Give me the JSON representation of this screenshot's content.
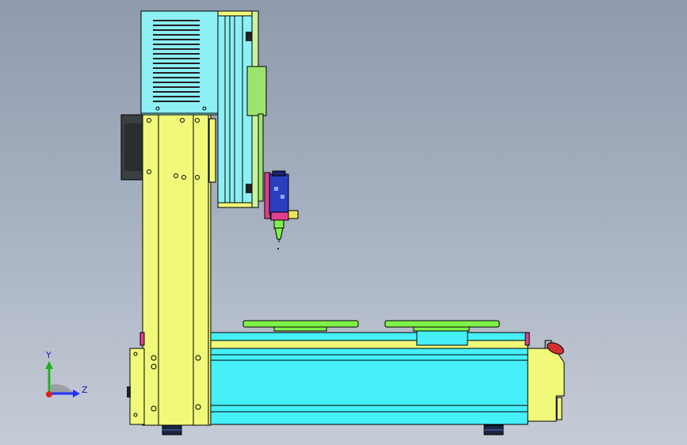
{
  "triad": {
    "y_label": "Y",
    "z_label": "Z"
  },
  "colors": {
    "background_top": "#8f9bad",
    "background_bottom": "#c6ccd6",
    "frame_yellow": "#f0f97a",
    "base_cyan": "#45f0f8",
    "head_cyan": "#8cf0f4",
    "fixture_green": "#7ff24a",
    "motor_dark": "#3a3f42",
    "estop_red": "#d23030",
    "dispense_blue": "#2a3fbf",
    "dispense_magenta": "#e0408f",
    "axis_y": "#1db31d",
    "axis_z": "#2030ff",
    "axis_x": "#e02020"
  }
}
